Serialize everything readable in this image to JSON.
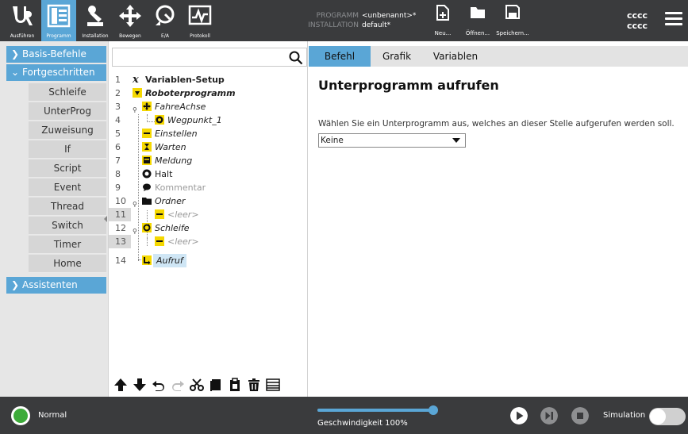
{
  "nav": {
    "run_label": "Ausführen",
    "program_label": "Programm",
    "installation_label": "Installation",
    "move_label": "Bewegen",
    "io_label": "E/A",
    "log_label": "Protokoll"
  },
  "program_info": {
    "program_key": "PROGRAMM",
    "program_value": "<unbenannt>*",
    "installation_key": "INSTALLATION",
    "installation_value": "default*"
  },
  "file": {
    "new_label": "Neu...",
    "open_label": "Öffnen...",
    "save_label": "Speichern..."
  },
  "header_right": {
    "line1": "cccc",
    "line2": "cccc"
  },
  "sidebar": {
    "basic": "Basis-Befehle",
    "advanced": "Fortgeschritten",
    "items": [
      "Schleife",
      "UnterProg",
      "Zuweisung",
      "If",
      "Script",
      "Event",
      "Thread",
      "Switch",
      "Timer",
      "Home"
    ],
    "wizards": "Assistenten"
  },
  "tree": {
    "rows": [
      {
        "num": "1",
        "text": "Variablen-Setup"
      },
      {
        "num": "2",
        "text": "Roboterprogramm"
      },
      {
        "num": "3",
        "text": "FahreAchse"
      },
      {
        "num": "4",
        "text": "Wegpunkt_1"
      },
      {
        "num": "5",
        "text": "Einstellen"
      },
      {
        "num": "6",
        "text": "Warten"
      },
      {
        "num": "7",
        "text": "Meldung"
      },
      {
        "num": "8",
        "text": "Halt"
      },
      {
        "num": "9",
        "text": "Kommentar"
      },
      {
        "num": "10",
        "text": "Ordner"
      },
      {
        "num": "11",
        "text": "<leer>"
      },
      {
        "num": "12",
        "text": "Schleife"
      },
      {
        "num": "13",
        "text": "<leer>"
      },
      {
        "num": "14",
        "text": "Aufruf"
      }
    ]
  },
  "tabs": [
    "Befehl",
    "Grafik",
    "Variablen"
  ],
  "content": {
    "title": "Unterprogramm aufrufen",
    "instruction": "Wählen Sie ein Unterprogramm aus, welches an dieser Stelle aufgerufen werden soll.",
    "dropdown_value": "Keine"
  },
  "bottom": {
    "status": "Normal",
    "speed_label": "Geschwindigkeit 100%",
    "speed_fraction": 1.0,
    "simulation_label": "Simulation",
    "simulation_on": false
  },
  "colors": {
    "accent": "#5aa6d6",
    "topbar": "#3a3b3d",
    "status_ok": "#3dab3a"
  }
}
